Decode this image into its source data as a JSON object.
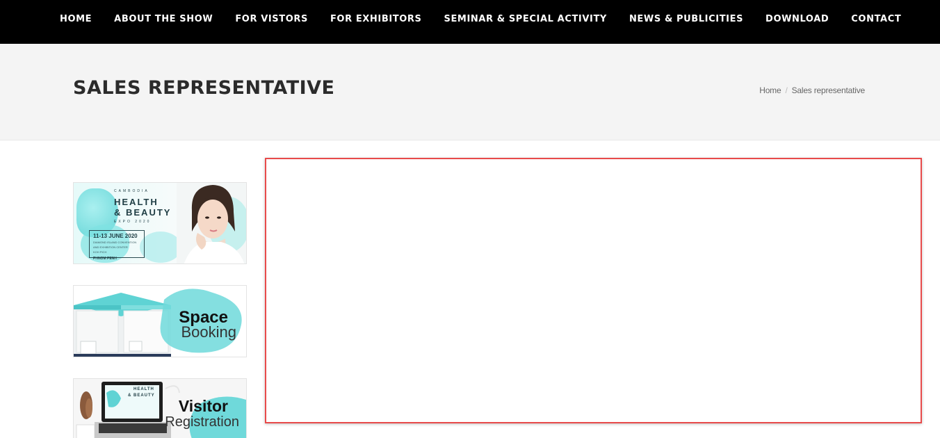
{
  "nav": {
    "items": [
      "HOME",
      "ABOUT THE SHOW",
      "FOR VISTORS",
      "FOR EXHIBITORS",
      "SEMINAR & SPECIAL ACTIVITY",
      "NEWS & PUBLICITIES",
      "DOWNLOAD",
      "CONTACT"
    ]
  },
  "page": {
    "title": "SALES REPRESENTATIVE",
    "breadcrumb": {
      "home": "Home",
      "separator": "/",
      "current": "Sales representative"
    }
  },
  "sidebar": {
    "banner1": {
      "country": "CAMBODIA",
      "line1": "HEALTH",
      "line2": "& BEAUTY",
      "sub": "EXPO 2020",
      "date": "11-13 JUNE 2020",
      "venue_line1": "DIAMOND ISLAND CONVENTION",
      "venue_line2": "AND EXHIBITION CENTER",
      "venue_line3": "KOH PICH",
      "city": "PHNOM PENH"
    },
    "banner2": {
      "line1": "Space",
      "line2": "Booking"
    },
    "banner3": {
      "line1": "Visitor",
      "line2": "Registration",
      "screen1": "HEALTH",
      "screen2": "& BEAUTY"
    }
  },
  "colors": {
    "nav_bg": "#000000",
    "accent_teal": "#5fd3d4",
    "highlight_border": "#e84a4a"
  }
}
